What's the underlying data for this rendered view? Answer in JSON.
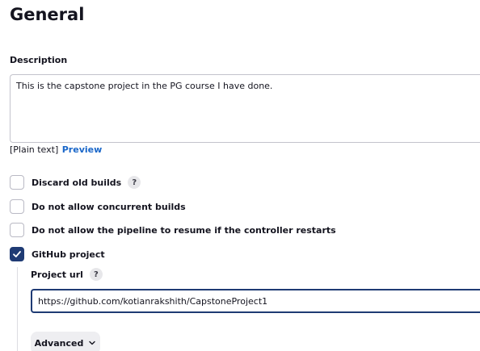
{
  "section": {
    "title": "General"
  },
  "description": {
    "label": "Description",
    "value": "This is the capstone project in the PG course I have done.",
    "format_text": "[Plain text]",
    "preview_label": "Preview"
  },
  "options": [
    {
      "label": "Discard old builds",
      "checked": false,
      "has_help": true
    },
    {
      "label": "Do not allow concurrent builds",
      "checked": false,
      "has_help": false
    },
    {
      "label": "Do not allow the pipeline to resume if the controller restarts",
      "checked": false,
      "has_help": false
    },
    {
      "label": "GitHub project",
      "checked": true,
      "has_help": false
    }
  ],
  "github": {
    "project_url_label": "Project url",
    "project_url_value": "https://github.com/kotianrakshith/CapstoneProject1",
    "advanced_label": "Advanced"
  },
  "help_glyph": "?",
  "colors": {
    "link": "#1a67c9",
    "checked": "#1f3b74",
    "text": "#14141f"
  }
}
